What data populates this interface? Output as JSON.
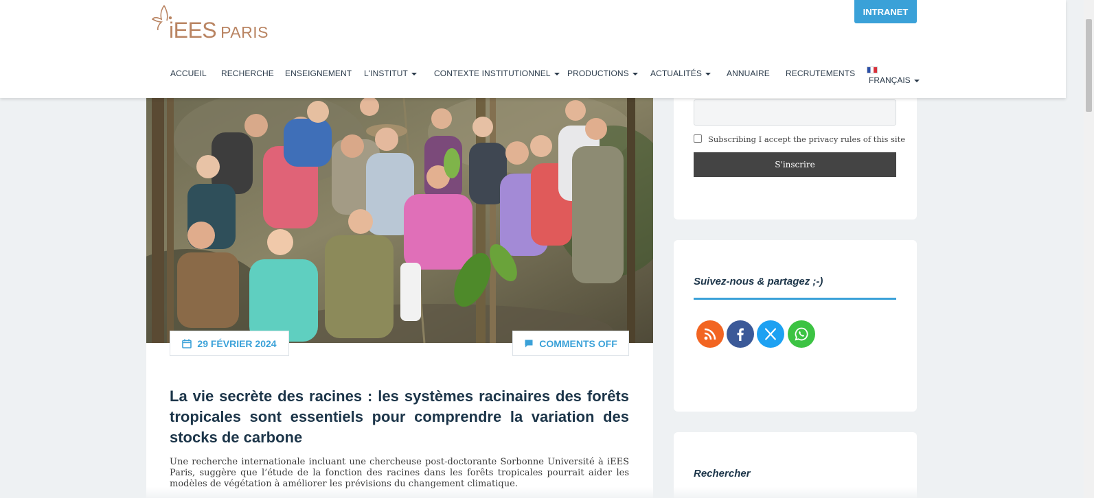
{
  "header": {
    "logo_text": "iEES",
    "logo_sub": "PARIS",
    "intranet_label": "INTRANET"
  },
  "nav": {
    "items": [
      {
        "label": "ACCUEIL"
      },
      {
        "label": "RECHERCHE"
      },
      {
        "label": "ENSEIGNEMENT"
      },
      {
        "label": "L'INSTITUT"
      },
      {
        "label": "CONTEXTE INSTITUTIONNEL"
      },
      {
        "label": "PRODUCTIONS"
      },
      {
        "label": "ACTUALITÉS"
      },
      {
        "label": "ANNUAIRE"
      },
      {
        "label": "RECRUTEMENTS"
      }
    ],
    "language": "FRANÇAIS"
  },
  "article": {
    "date": "29 FÉVRIER 2024",
    "comments": "COMMENTS OFF",
    "title": "La vie secrète des racines : les systèmes racinaires des forêts tropicales sont essentiels pour comprendre la variation des stocks de carbone",
    "excerpt": "Une recherche internationale incluant une chercheuse post-doctorante Sorbonne Université à iEES Paris, suggère que l’étude de la fonction des racines dans les forêts tropicales pourrait aider les modèles de végétation à améliorer les prévisions du changement climatique."
  },
  "sidebar": {
    "subscribe": {
      "input_value": "",
      "privacy_text": "Subscribing I accept the privacy rules of this site",
      "button_label": "S'inscrire"
    },
    "follow_title": "Suivez-nous & partagez ;-)",
    "social": [
      {
        "name": "rss-icon",
        "color": "#f26522"
      },
      {
        "name": "facebook-icon",
        "color": "#3b5998"
      },
      {
        "name": "x-twitter-icon",
        "color": "#1da1f2"
      },
      {
        "name": "whatsapp-icon",
        "color": "#3cc343"
      }
    ],
    "search_title": "Rechercher"
  },
  "colors": {
    "accent": "#3aa1d8",
    "logo": "#b98462",
    "title": "#1c3549",
    "button_dark": "#444444"
  }
}
